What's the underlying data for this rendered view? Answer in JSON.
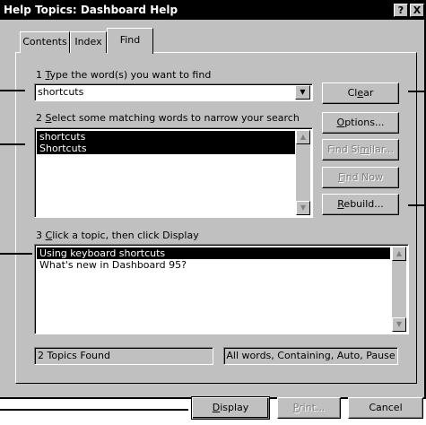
{
  "window": {
    "title": "Help Topics: Dashboard Help",
    "help_glyph": "?",
    "close_glyph": "X"
  },
  "tabs": [
    {
      "label": "Contents",
      "active": false
    },
    {
      "label": "Index",
      "active": false
    },
    {
      "label": "Find",
      "active": true
    }
  ],
  "step1": {
    "num": "1 ",
    "accel": "T",
    "rest": "ype the word(s) you want to find",
    "value": "shortcuts"
  },
  "step2": {
    "num": "2 ",
    "accel": "S",
    "rest": "elect some matching words to narrow your search",
    "items": [
      {
        "label": "shortcuts",
        "selected": true
      },
      {
        "label": "Shortcuts",
        "selected": true
      }
    ]
  },
  "step3": {
    "num": "3 ",
    "accel": "C",
    "rest": "lick a topic, then click Display",
    "items": [
      {
        "label": "Using keyboard shortcuts",
        "selected": true
      },
      {
        "label": "What's new in Dashboard 95?",
        "selected": false
      }
    ]
  },
  "buttons": {
    "clear": {
      "pre": "Cl",
      "accel": "e",
      "post": "ar"
    },
    "options": {
      "pre": "",
      "accel": "O",
      "post": "ptions..."
    },
    "find_similar": {
      "pre": "Find Si",
      "accel": "m",
      "post": "ilar..."
    },
    "find_now": {
      "pre": "",
      "accel": "F",
      "post": "ind Now"
    },
    "rebuild": {
      "pre": "",
      "accel": "R",
      "post": "ebuild..."
    },
    "display": {
      "pre": "",
      "accel": "D",
      "post": "isplay"
    },
    "print": {
      "pre": "",
      "accel": "P",
      "post": "rint..."
    },
    "cancel": {
      "label": "Cancel"
    }
  },
  "status": {
    "found": "2 Topics Found",
    "options": "All words, Containing, Auto, Pause"
  },
  "icons": {
    "dropdown": "▼",
    "scroll_up": "▲",
    "scroll_down": "▼"
  }
}
